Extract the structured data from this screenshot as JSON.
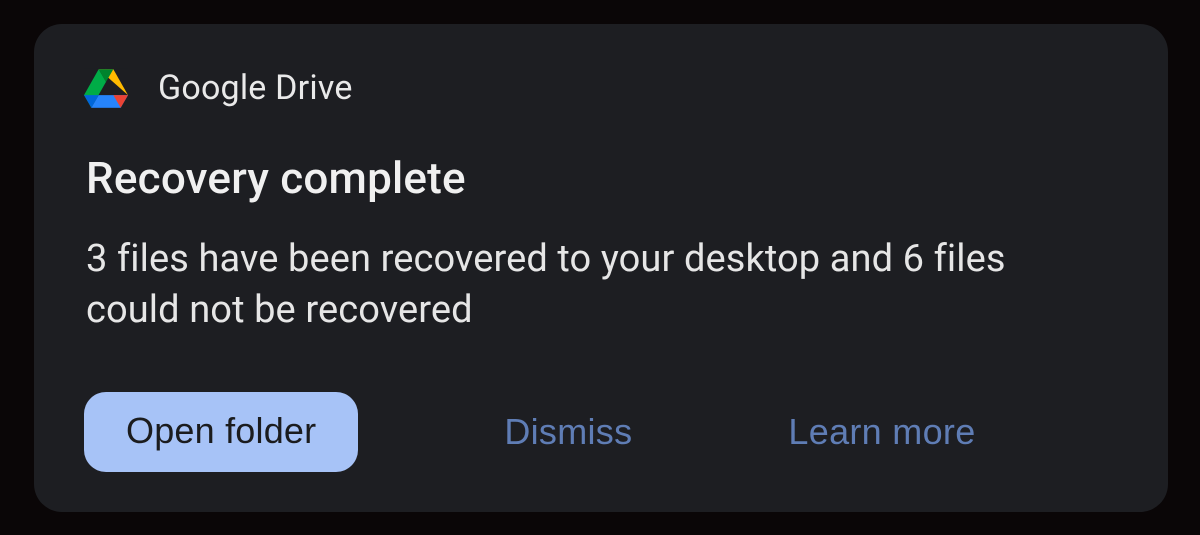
{
  "header": {
    "app_name": "Google Drive",
    "icon": "google-drive"
  },
  "content": {
    "title": "Recovery complete",
    "body": "3 files have been recovered to your desktop and 6 files could not be recovered"
  },
  "actions": {
    "primary_label": "Open folder",
    "dismiss_label": "Dismiss",
    "learn_more_label": "Learn more"
  },
  "colors": {
    "card_bg": "#1d1e22",
    "primary_button_bg": "#a7c3f7",
    "text_button_fg": "#5f7db5"
  }
}
